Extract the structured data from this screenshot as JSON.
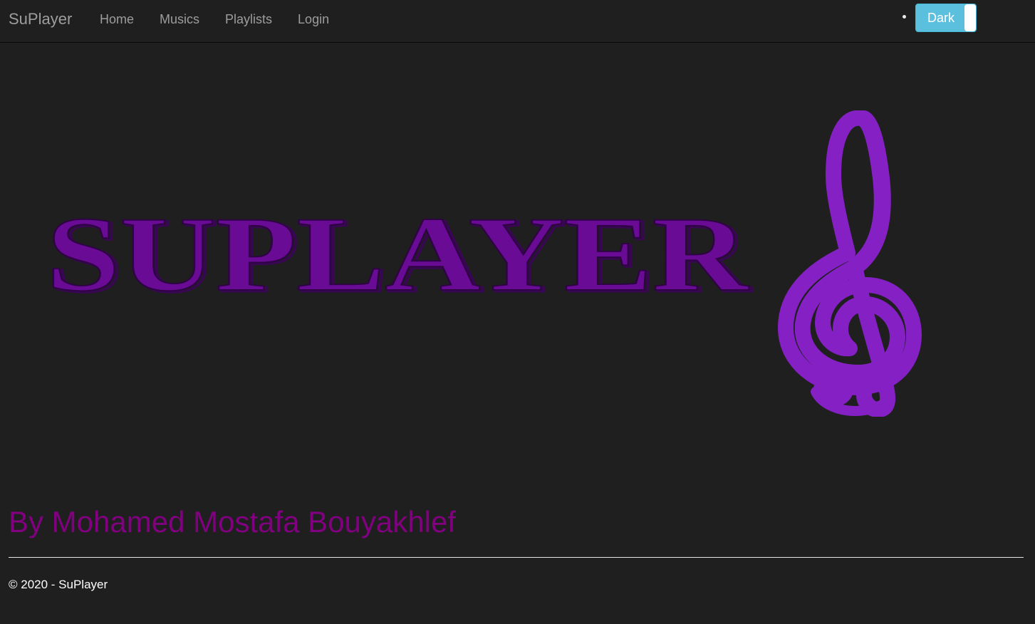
{
  "navbar": {
    "brand": "SuPlayer",
    "links": [
      {
        "label": "Home"
      },
      {
        "label": "Musics"
      },
      {
        "label": "Playlists"
      },
      {
        "label": "Login"
      }
    ],
    "theme_toggle": {
      "label": "Dark"
    }
  },
  "hero": {
    "logo_text": "SUPLAYER",
    "logo_color": "#6a0b96",
    "clef_color": "#8520c4"
  },
  "main": {
    "author": "By Mohamed Mostafa Bouyakhlef"
  },
  "footer": {
    "text": "© 2020 - SuPlayer"
  },
  "colors": {
    "background": "#1f1f1f",
    "nav_text": "#9d9d9d",
    "author_text": "#800080",
    "toggle_bg": "#5bc0de"
  }
}
